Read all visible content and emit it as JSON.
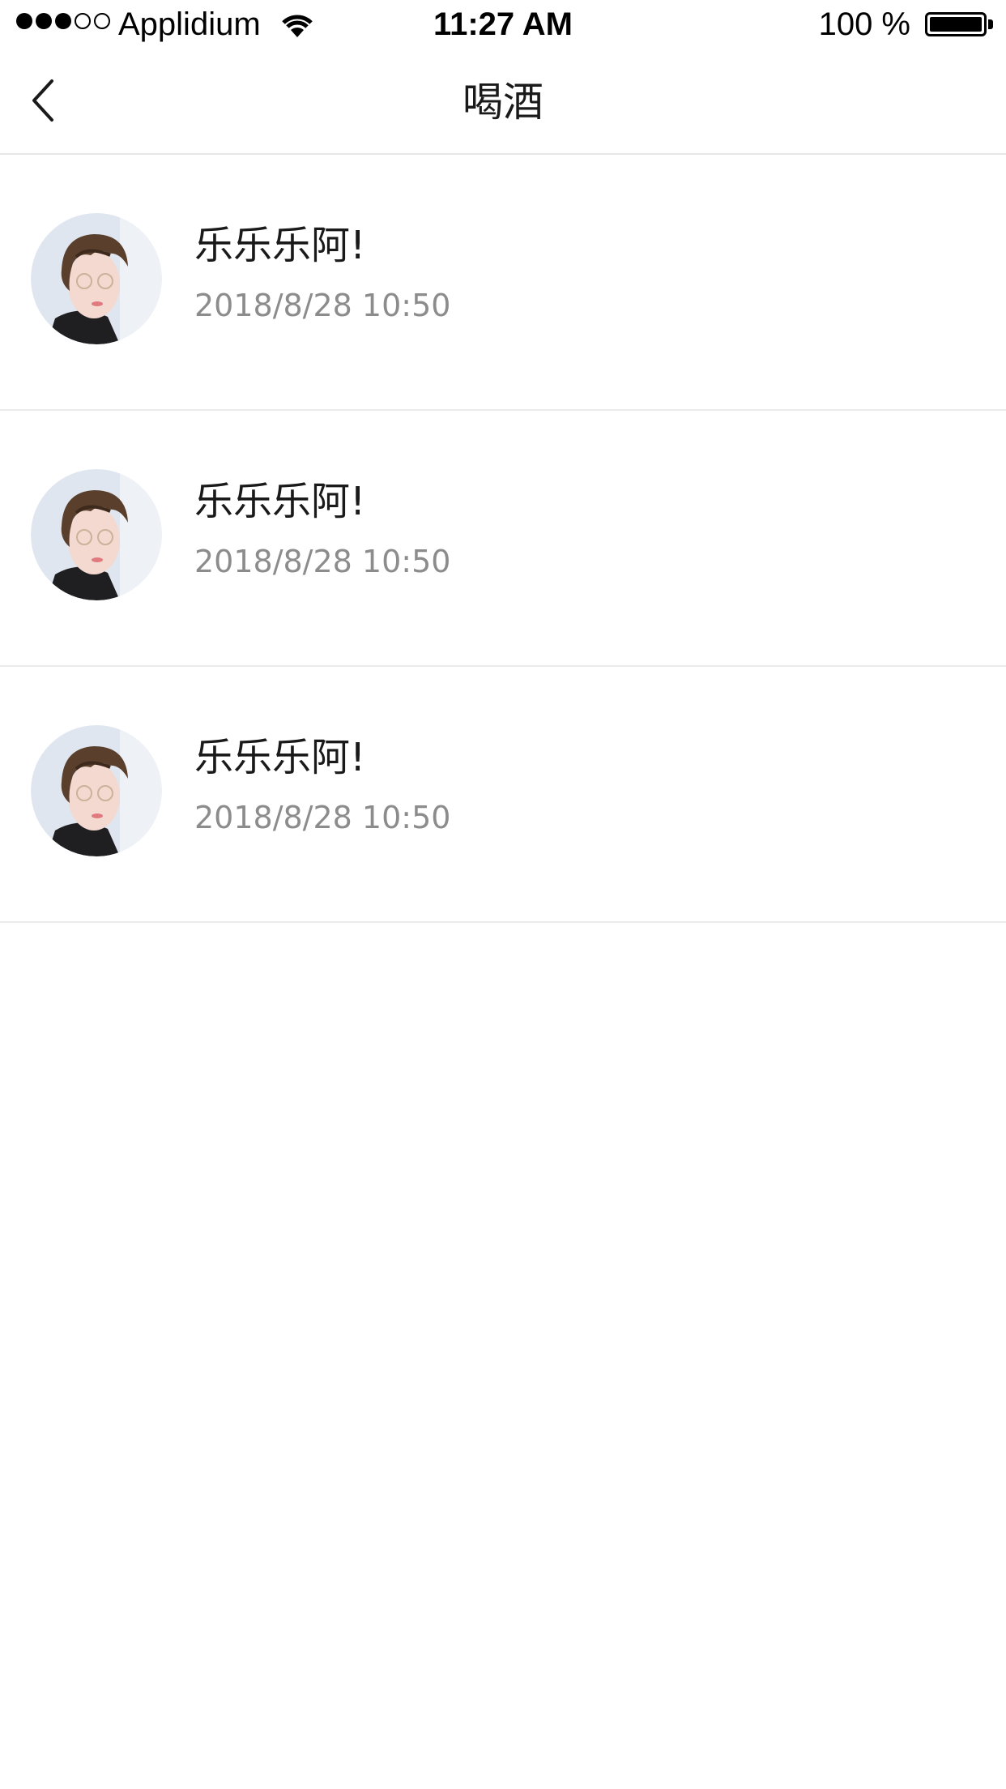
{
  "status_bar": {
    "carrier": "Applidium",
    "time": "11:27 AM",
    "battery": "100 %",
    "signal_bars": 3,
    "signal_total": 5,
    "icons": [
      "signal-dots-icon",
      "wifi-icon",
      "battery-icon"
    ]
  },
  "nav": {
    "title": "喝酒",
    "back_icon": "chevron-left-icon"
  },
  "list": {
    "items": [
      {
        "name": "乐乐乐阿!",
        "time": "2018/8/28  10:50",
        "avatar_icon": "avatar-image"
      },
      {
        "name": "乐乐乐阿!",
        "time": "2018/8/28  10:50",
        "avatar_icon": "avatar-image"
      },
      {
        "name": "乐乐乐阿!",
        "time": "2018/8/28  10:50",
        "avatar_icon": "avatar-image"
      }
    ]
  },
  "colors": {
    "primary_text": "#1a1a1a",
    "secondary_text": "#8c8c8c",
    "divider": "#ebebeb",
    "background": "#ffffff"
  }
}
